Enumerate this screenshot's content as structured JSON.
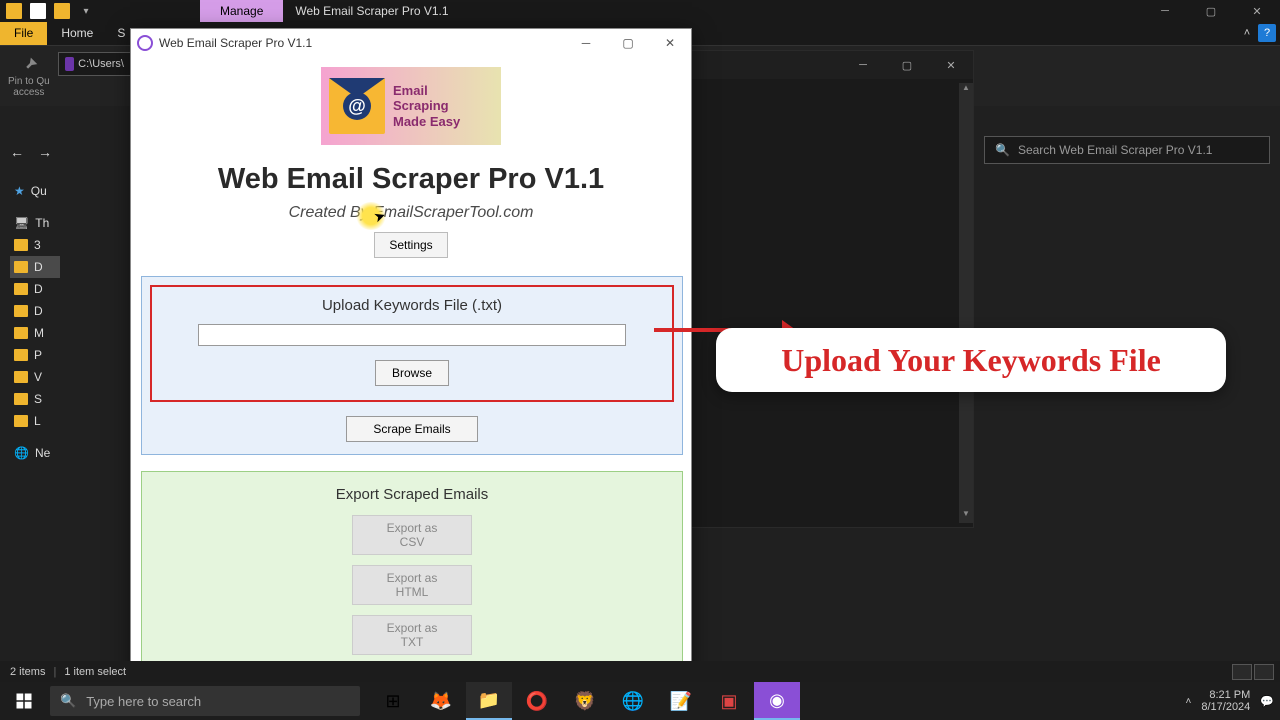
{
  "explorer": {
    "ribbon_manage": "Manage",
    "app_title_tab": "Web Email Scraper Pro V1.1",
    "file": "File",
    "home": "Home",
    "share_partial": "S",
    "pin_line1": "Pin to Qu",
    "pin_line2": "access",
    "address": "C:\\Users\\",
    "search_placeholder": "Search Web Email Scraper Pro V1.1"
  },
  "sidebar": {
    "quick": "Qu",
    "thispc": "Th",
    "d3": "3",
    "dd1": "D",
    "dd2": "D",
    "dd3": "D",
    "dm": "M",
    "dp": "P",
    "dv": "V",
    "ds": "S",
    "dl": "L",
    "net": "Ne"
  },
  "status": {
    "items": "2 items",
    "selected": "1 item select"
  },
  "app": {
    "title_bar": "Web Email Scraper Pro V1.1",
    "brand_line1": "Email",
    "brand_line2": "Scraping",
    "brand_line3": "Made Easy",
    "main_title": "Web Email Scraper Pro V1.1",
    "subtitle": "Created By EmailScraperTool.com",
    "settings_btn": "Settings",
    "upload_label": "Upload Keywords File (.txt)",
    "browse_btn": "Browse",
    "scrape_btn": "Scrape Emails",
    "export_label": "Export Scraped Emails",
    "export_csv": "Export as CSV",
    "export_html": "Export as HTML",
    "export_txt": "Export as TXT"
  },
  "annotation": {
    "callout": "Upload Your Keywords File"
  },
  "taskbar": {
    "search": "Type here to search",
    "time": "8:21 PM",
    "date": "8/17/2024"
  }
}
